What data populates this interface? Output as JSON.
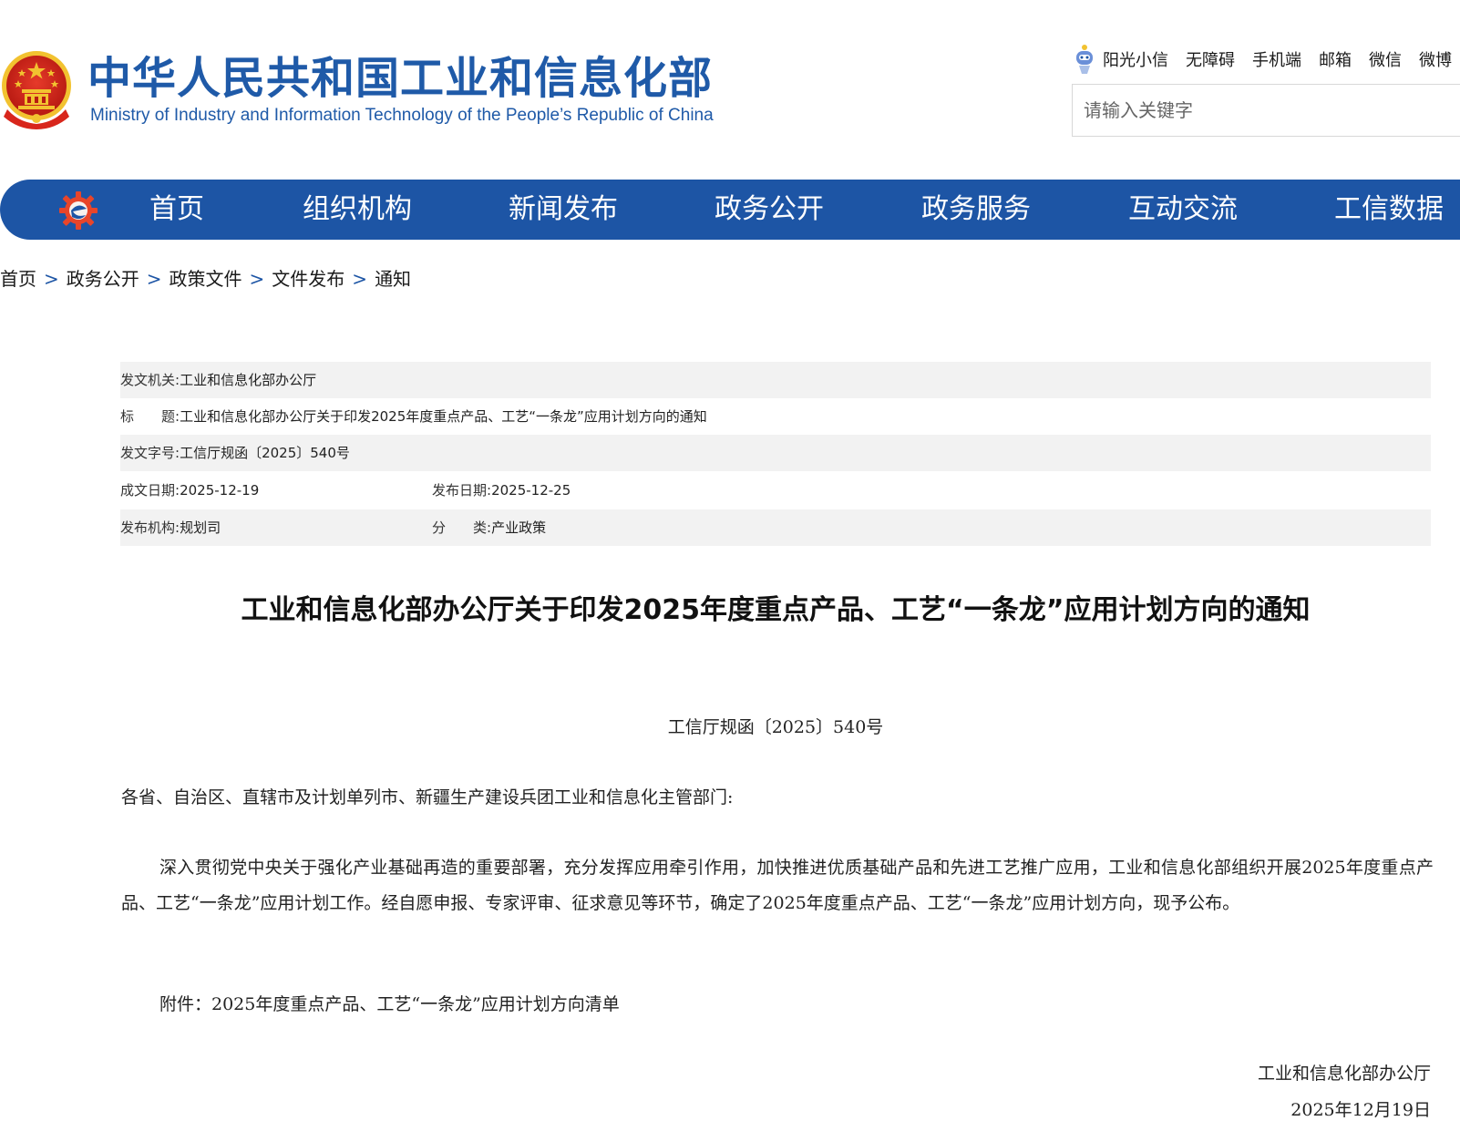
{
  "header": {
    "title": "中华人民共和国工业和信息化部",
    "subtitle": "Ministry of Industry and Information Technology of the People’s Republic of China",
    "top_links": [
      "阳光小信",
      "无障碍",
      "手机端",
      "邮箱",
      "微信",
      "微博"
    ],
    "search_placeholder": "请输入关键字"
  },
  "nav": {
    "items": [
      "首页",
      "组织机构",
      "新闻发布",
      "政务公开",
      "政务服务",
      "互动交流",
      "工信数据"
    ]
  },
  "breadcrumb": [
    "首页",
    "政务公开",
    "政策文件",
    "文件发布",
    "通知"
  ],
  "breadcrumb_sep": ">",
  "info": {
    "issuer_label": "发文机关:",
    "issuer": "工业和信息化部办公厅",
    "title_label": "标　　题:",
    "title": "工业和信息化部办公厅关于印发2025年度重点产品、工艺“一条龙”应用计划方向的通知",
    "doc_no_label": "发文字号:",
    "doc_no": "工信厅规函〔2025〕540号",
    "written_date_label": "成文日期:",
    "written_date": "2025-12-19",
    "publish_date_label": "发布日期:",
    "publish_date": "2025-12-25",
    "publisher_label": "发布机构:",
    "publisher": "规划司",
    "category_label": "分　　类:",
    "category": "产业政策"
  },
  "article": {
    "title": "工业和信息化部办公厅关于印发2025年度重点产品、工艺“一条龙”应用计划方向的通知",
    "doc_number": "工信厅规函〔2025〕540号",
    "salutation": "各省、自治区、直辖市及计划单列市、新疆生产建设兵团工业和信息化主管部门:",
    "paragraph": "深入贯彻党中央关于强化产业基础再造的重要部署，充分发挥应用牵引作用，加快推进优质基础产品和先进工艺推广应用，工业和信息化部组织开展2025年度重点产品、工艺“一条龙”应用计划工作。经自愿申报、专家评审、征求意见等环节，确定了2025年度重点产品、工艺“一条龙”应用计划方向，现予公布。",
    "attachment": "附件：2025年度重点产品、工艺“一条龙”应用计划方向清单",
    "sign_org": "工业和信息化部办公厅",
    "sign_date": "2025年12月19日"
  },
  "colors": {
    "brand_blue": "#1d55a5",
    "title_blue": "#1f5aa8",
    "emblem_red": "#d8261c",
    "emblem_gold": "#f2c230",
    "row_shade": "#f2f2f2"
  },
  "icons": {
    "emblem": "national-emblem-icon",
    "robot": "assistant-robot-icon",
    "nav_logo": "ministry-logo-icon"
  }
}
